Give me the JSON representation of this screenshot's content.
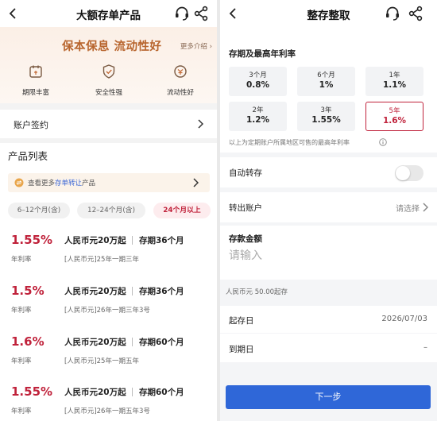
{
  "left": {
    "header": {
      "title": "大额存单产品"
    },
    "banner": {
      "slogan": "保本保息 流动性好",
      "more_link": "更多介绍 ›",
      "features": [
        {
          "icon": "calendar-icon",
          "label": "期限丰富"
        },
        {
          "icon": "shield-icon",
          "label": "安全性强"
        },
        {
          "icon": "exchange-icon",
          "label": "流动性好"
        }
      ]
    },
    "account_sign": {
      "label": "账户签约"
    },
    "product_list": {
      "title": "产品列表",
      "promo": {
        "prefix": "查看更多",
        "highlight": "存单转让",
        "suffix": "产品"
      },
      "filters": [
        {
          "label": "6–12个月(含)",
          "active": false
        },
        {
          "label": "12–24个月(含)",
          "active": false
        },
        {
          "label": "24个月以上",
          "active": true
        }
      ],
      "items": [
        {
          "rate": "1.55%",
          "rate_label": "年利率",
          "amount": "人民币元20万起",
          "term": "存期36个月",
          "code": "[人民币元]25年一期三年"
        },
        {
          "rate": "1.5%",
          "rate_label": "年利率",
          "amount": "人民币元20万起",
          "term": "存期36个月",
          "code": "[人民币元]26年一期三年3号"
        },
        {
          "rate": "1.6%",
          "rate_label": "年利率",
          "amount": "人民币元20万起",
          "term": "存期60个月",
          "code": "[人民币元]25年一期五年"
        },
        {
          "rate": "1.55%",
          "rate_label": "年利率",
          "amount": "人民币元20万起",
          "term": "存期60个月",
          "code": "[人民币元]26年一期五年3号"
        }
      ]
    }
  },
  "right": {
    "header": {
      "title": "整存整取"
    },
    "rates": {
      "title": "存期及最高年利率",
      "options": [
        {
          "term": "3个月",
          "rate": "0.8%",
          "selected": false
        },
        {
          "term": "6个月",
          "rate": "1%",
          "selected": false
        },
        {
          "term": "1年",
          "rate": "1.1%",
          "selected": false
        },
        {
          "term": "2年",
          "rate": "1.2%",
          "selected": false
        },
        {
          "term": "3年",
          "rate": "1.55%",
          "selected": false
        },
        {
          "term": "5年",
          "rate": "1.6%",
          "selected": true
        }
      ],
      "note": "以上为定期账户所属地区可售的最高年利率"
    },
    "auto_renew": {
      "label": "自动转存",
      "enabled": false
    },
    "out_account": {
      "label": "转出账户",
      "value": "请选择"
    },
    "amount": {
      "label": "存款金额",
      "placeholder": "请输入",
      "min_note": "人民币元 50.00起存"
    },
    "start_date": {
      "label": "起存日",
      "value": "2026/07/03"
    },
    "end_date": {
      "label": "到期日",
      "value": "–"
    },
    "next_button": {
      "label": "下一步"
    }
  },
  "colors": {
    "accent_red": "#c0223b",
    "primary_blue": "#2f67d8",
    "banner_gold": "#b8652e"
  }
}
